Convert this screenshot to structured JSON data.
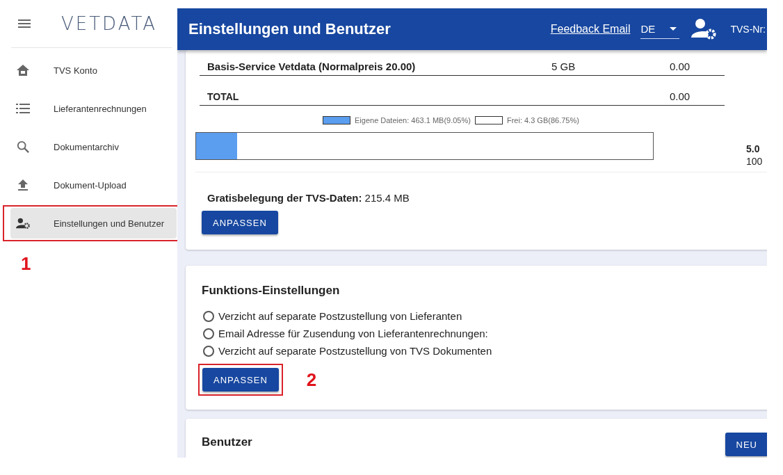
{
  "sidebar": {
    "logo": "VETDATA",
    "items": [
      {
        "label": "TVS Konto",
        "selected": false,
        "highlighted": false
      },
      {
        "label": "Lieferantenrechnungen",
        "selected": false,
        "highlighted": false
      },
      {
        "label": "Dokumentarchiv",
        "selected": false,
        "highlighted": false
      },
      {
        "label": "Dokument-Upload",
        "selected": false,
        "highlighted": false
      },
      {
        "label": "Einstellungen und Benutzer",
        "selected": true,
        "highlighted": true
      }
    ],
    "annotation": "1"
  },
  "header": {
    "title": "Einstellungen und Benutzer",
    "link": "Feedback Email",
    "language": "DE",
    "account_label": "TVS-Nr:"
  },
  "storage_card": {
    "rows": [
      {
        "kind": "item",
        "name": "Basis-Service Vetdata (Normalpreis 20.00)",
        "size": "5 GB",
        "price": "0.00"
      },
      {
        "kind": "total",
        "name": "TOTAL",
        "size": "",
        "price": "0.00"
      }
    ],
    "legend": [
      {
        "label": "Eigene Dateien: 463.1 MB(9.05%)",
        "color": "#5b9ef0"
      },
      {
        "label": "Frei: 4.3 GB(86.75%)",
        "color": "#ffffff"
      }
    ],
    "bar": {
      "level": 0.0905
    },
    "total_size": "5.0",
    "total_percent": "100",
    "free_label": "Gratisbelegung der TVS-Daten:",
    "free_value": "215.4 MB",
    "button": "ANPASSEN"
  },
  "function_card": {
    "title": "Funktions-Einstellungen",
    "options": [
      {
        "label": "Verzicht auf separate Postzustellung von Lieferanten",
        "selected": false
      },
      {
        "label": "Email Adresse für Zusendung von Lieferantenrechnungen:",
        "selected": false
      },
      {
        "label": "Verzicht auf separate Postzustellung von TVS Dokumenten",
        "selected": false
      }
    ],
    "button": "ANPASSEN",
    "button_highlighted": true,
    "annotation": "2"
  },
  "users_card": {
    "title": "Benutzer",
    "button": "NEU"
  }
}
